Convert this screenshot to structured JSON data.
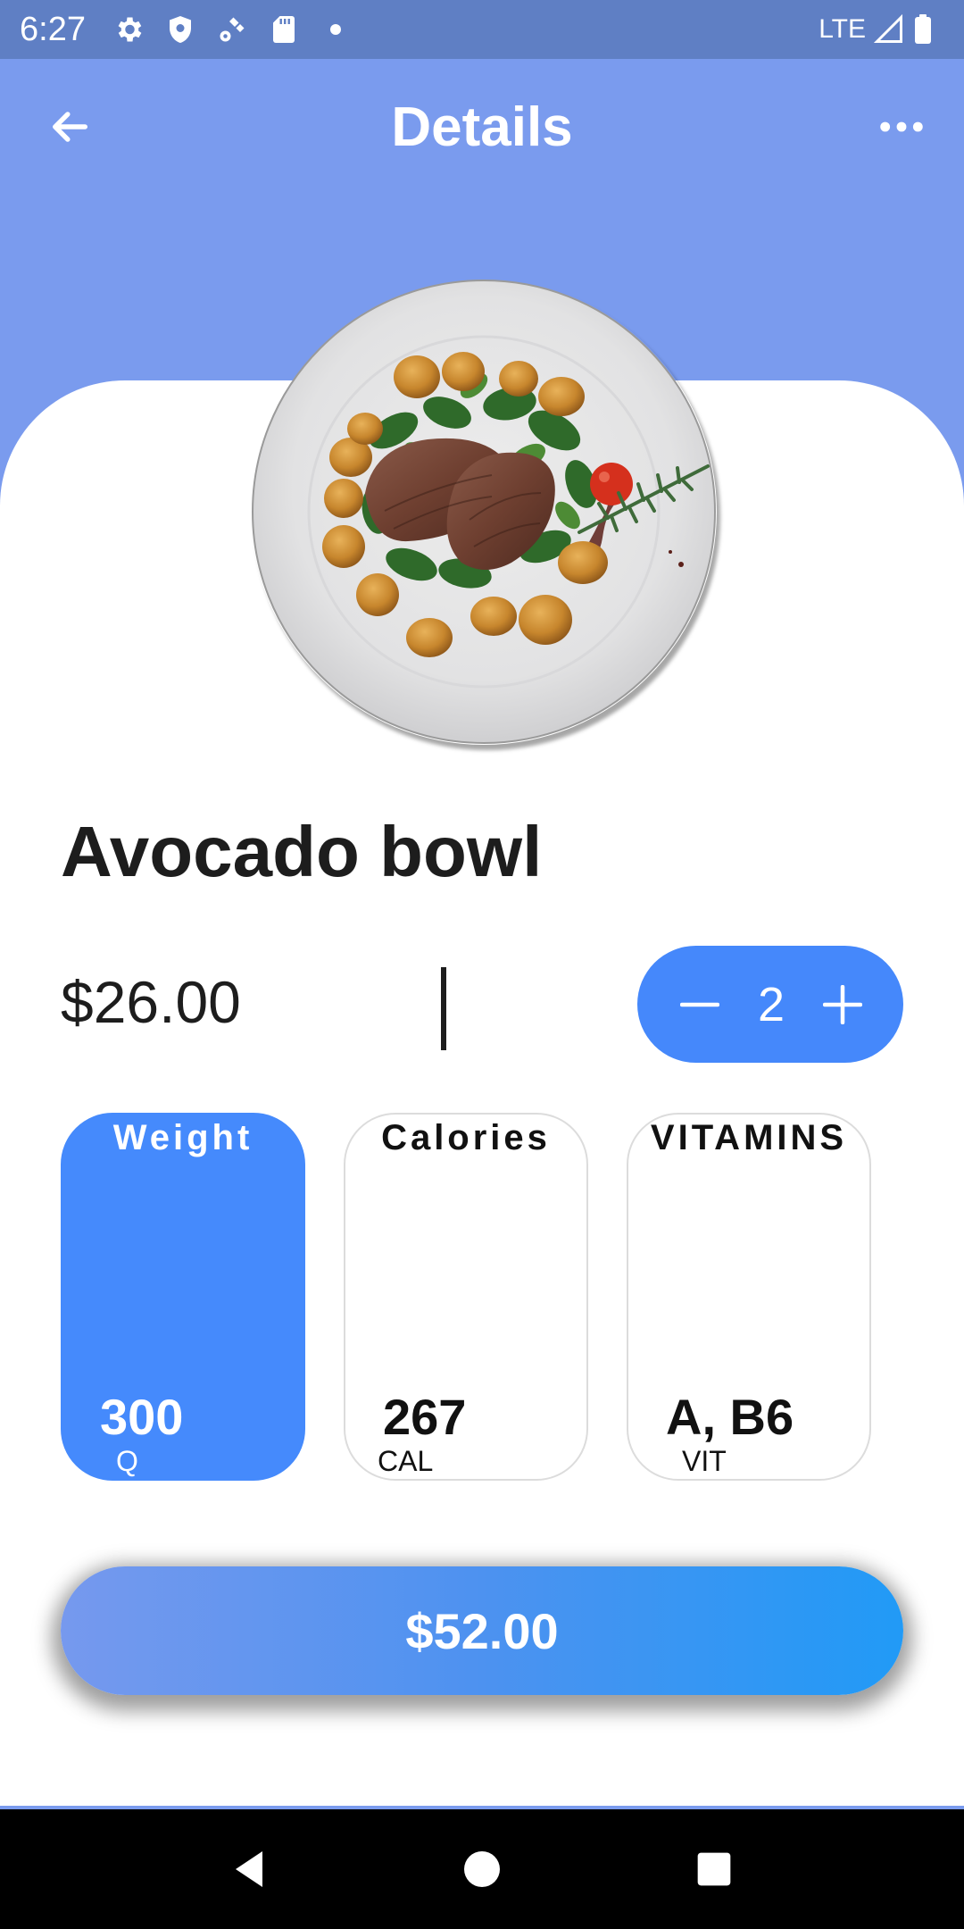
{
  "status_bar": {
    "time": "6:27",
    "network": "LTE",
    "icons": [
      "settings-icon",
      "shield-icon",
      "satellite-icon",
      "sd-card-icon",
      "dot-icon",
      "signal-icon",
      "battery-icon"
    ]
  },
  "app_bar": {
    "title": "Details",
    "back_icon": "arrow-left-icon",
    "more_icon": "more-horizontal-icon"
  },
  "item": {
    "image": "plate-steak-potatoes-spinach",
    "name": "Avocado bowl",
    "price": "$26.00",
    "quantity": "2"
  },
  "nutrients": [
    {
      "label": "Weight",
      "value": "300",
      "unit": "Q",
      "selected": true
    },
    {
      "label": "Calories",
      "value": "267",
      "unit": "CAL",
      "selected": false
    },
    {
      "label": "VITAMINS",
      "value": "A, B6",
      "unit": "VIT",
      "selected": false
    }
  ],
  "total_button": {
    "label": "$52.00"
  },
  "colors": {
    "header_bg": "#7a9bee",
    "status_bar_bg": "#5f7fc4",
    "accent_blue": "#458afc",
    "gradient_start": "#7699ee",
    "gradient_end": "#219af6"
  },
  "nav_bar": {
    "icons": [
      "back-triangle-icon",
      "home-circle-icon",
      "recents-square-icon"
    ]
  }
}
